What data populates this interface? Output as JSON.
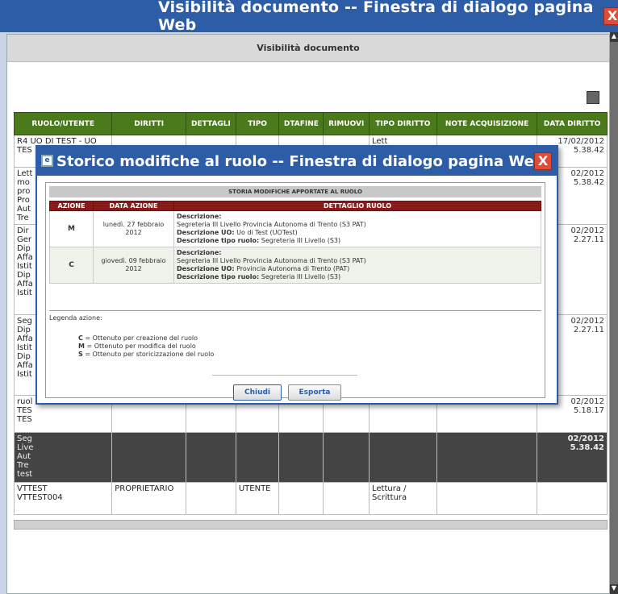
{
  "outer_window": {
    "title": "Visibilità documento -- Finestra di dialogo pagina Web",
    "close_glyph": "X",
    "subtitle": "Visibilità documento"
  },
  "main_table": {
    "headers": [
      "RUOLO/UTENTE",
      "DIRITTI",
      "DETTAGLI",
      "TIPO",
      "DTAFINE",
      "RIMUOVI",
      "TIPO DIRITTO",
      "NOTE ACQUISIZIONE",
      "DATA DIRITTO"
    ],
    "rows": [
      {
        "ruolo": "R4 UO DI TEST - UO\nTES",
        "diritti": "",
        "dettagli": "",
        "tipo": "",
        "dtafine": "",
        "rimuovi": "",
        "tipo_diritto": "Lett",
        "note": "",
        "data": "17/02/2012\n5.38.42",
        "style": "light"
      },
      {
        "ruolo": "Lett\nmo\npro\nPro\nAut\nTre",
        "diritti": "",
        "dettagli": "",
        "tipo": "",
        "dtafine": "",
        "rimuovi": "",
        "tipo_diritto": "",
        "note": "",
        "data": "02/2012\n5.38.42",
        "style": "light"
      },
      {
        "ruolo": "Dir\nGer\nDip\nAffa\nIstit\nDip\nAffa\nIstit",
        "diritti": "",
        "dettagli": "",
        "tipo": "",
        "dtafine": "",
        "rimuovi": "",
        "tipo_diritto": "",
        "note": "",
        "data": "02/2012\n2.27.11",
        "style": "light"
      },
      {
        "ruolo": "Seg\nDip\nAffa\nIstit\nDip\nAffa\nIstit",
        "diritti": "",
        "dettagli": "",
        "tipo": "",
        "dtafine": "",
        "rimuovi": "",
        "tipo_diritto": "",
        "note": "",
        "data": "02/2012\n2.27.11",
        "style": "light"
      },
      {
        "ruolo": "ruol\nTES\nTES",
        "diritti": "",
        "dettagli": "",
        "tipo": "",
        "dtafine": "",
        "rimuovi": "",
        "tipo_diritto": "",
        "note": "",
        "data": "02/2012\n5.18.17",
        "style": "light"
      },
      {
        "ruolo": "Seg\nLive\nAut\nTre\ntest",
        "diritti": "",
        "dettagli": "",
        "tipo": "",
        "dtafine": "",
        "rimuovi": "",
        "tipo_diritto": "",
        "note": "",
        "data": "02/2012\n5.38.42",
        "style": "dark"
      },
      {
        "ruolo": "VTTEST\nVTTEST004",
        "diritti": "PROPRIETARIO",
        "dettagli": "",
        "tipo": "UTENTE",
        "dtafine": "",
        "rimuovi": "",
        "tipo_diritto": "Lettura /\nScrittura",
        "note": "",
        "data": "",
        "style": "light"
      }
    ]
  },
  "inner_window": {
    "title": "Storico modifiche al ruolo -- Finestra di dialogo pagina Web",
    "close_glyph": "X",
    "section_header": "STORIA MODIFICHE APPORTATE AL RUOLO",
    "columns": [
      "AZIONE",
      "DATA AZIONE",
      "DETTAGLIO RUOLO"
    ],
    "rows": [
      {
        "azione": "M",
        "data": "lunedì. 27 febbraio 2012",
        "descrizione_label": "Descrizione:",
        "descrizione": "Segreteria III Livello Provincia Autonoma di Trento (S3 PAT)",
        "uo_label": "Descrizione UO:",
        "uo": "Uo di Test (UOTest)",
        "tipo_label": "Descrizione tipo ruolo:",
        "tipo": "Segreteria III Livello (S3)"
      },
      {
        "azione": "C",
        "data": "giovedì. 09 febbraio 2012",
        "descrizione_label": "Descrizione:",
        "descrizione": "Segreteria III Livello Provincia Autonoma di Trento (S3 PAT)",
        "uo_label": "Descrizione UO:",
        "uo": "Provincia Autonoma di Trento (PAT)",
        "tipo_label": "Descrizione tipo ruolo:",
        "tipo": "Segreteria III Livello (S3)"
      }
    ],
    "legend_title": "Legenda azione:",
    "legend": [
      {
        "key": "C",
        "text": "= Ottenuto per creazione del ruolo"
      },
      {
        "key": "M",
        "text": "= Ottenuto per modifica del ruolo"
      },
      {
        "key": "S",
        "text": "= Ottenuto per storicizzazione del ruolo"
      }
    ],
    "buttons": {
      "close": "Chiudi",
      "export": "Esporta"
    }
  },
  "icons": [
    "print-icon",
    "close-icon",
    "app-icon"
  ]
}
